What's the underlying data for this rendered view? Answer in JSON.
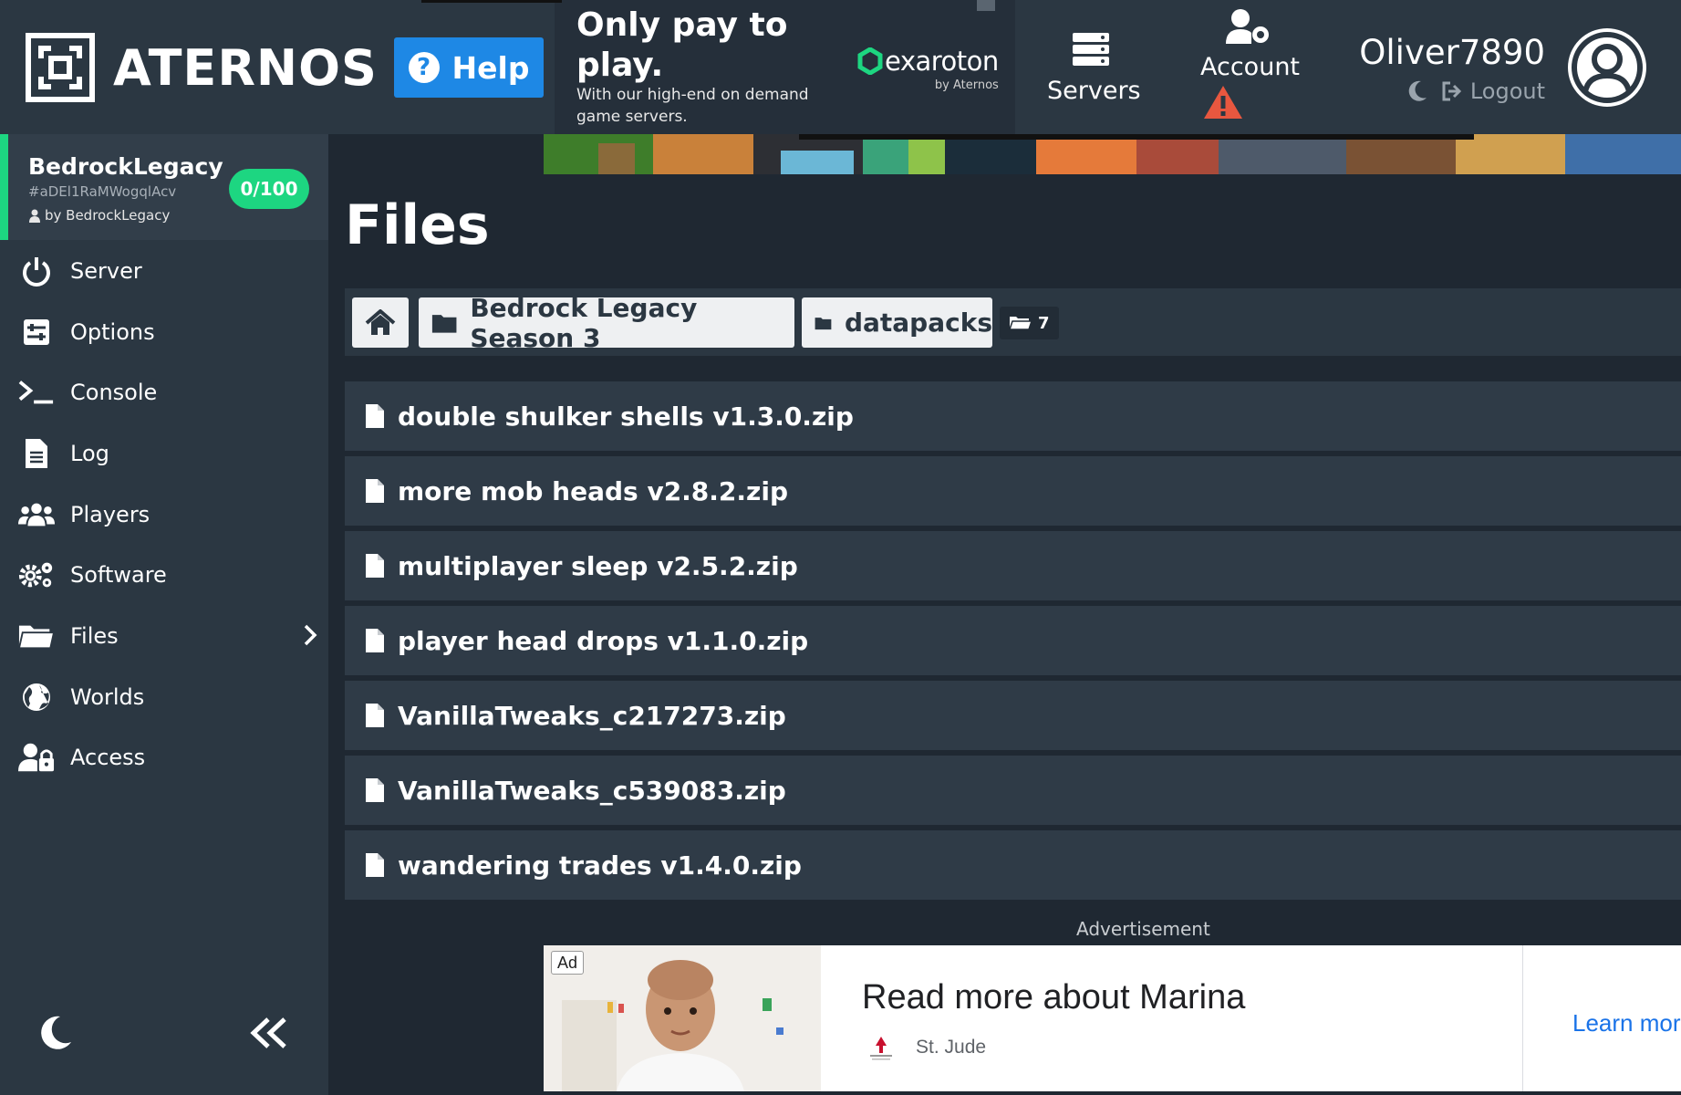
{
  "header": {
    "brand": "ATERNOS",
    "help_label": "Help",
    "top_ad": {
      "headline": "Only pay to play.",
      "subtext": "With our high-end on demand game servers.",
      "sponsor_name": "exaroton",
      "sponsor_by": "by Aternos"
    },
    "nav": {
      "servers_label": "Servers",
      "account_label": "Account"
    },
    "user": {
      "username": "Oliver7890",
      "logout_label": "Logout"
    }
  },
  "sidebar": {
    "server": {
      "name": "BedrockLegacy",
      "id": "#aDEl1RaMWogqlAcv",
      "owner": "by BedrockLegacy",
      "player_count": "0/100"
    },
    "items": [
      {
        "label": "Server",
        "icon": "power-icon"
      },
      {
        "label": "Options",
        "icon": "sliders-icon"
      },
      {
        "label": "Console",
        "icon": "terminal-icon"
      },
      {
        "label": "Log",
        "icon": "document-icon"
      },
      {
        "label": "Players",
        "icon": "users-icon"
      },
      {
        "label": "Software",
        "icon": "gears-icon"
      },
      {
        "label": "Files",
        "icon": "folder-open-icon"
      },
      {
        "label": "Worlds",
        "icon": "globe-icon"
      },
      {
        "label": "Access",
        "icon": "user-lock-icon"
      }
    ]
  },
  "main": {
    "title": "Files",
    "breadcrumb": {
      "items": [
        "Bedrock Legacy Season 3",
        "datapacks"
      ],
      "count": "7"
    },
    "files": [
      "double shulker shells v1.3.0.zip",
      "more mob heads v2.8.2.zip",
      "multiplayer sleep v2.5.2.zip",
      "player head drops v1.1.0.zip",
      "VanillaTweaks_c217273.zip",
      "VanillaTweaks_c539083.zip",
      "wandering trades v1.4.0.zip"
    ],
    "advertisement_label": "Advertisement",
    "bottom_ad": {
      "tag": "Ad",
      "headline": "Read more about Marina",
      "sponsor": "St. Jude",
      "cta": "Learn more"
    }
  },
  "colors": {
    "background": "#1f2832",
    "panel": "#2b3742",
    "accent_green": "#1dd681",
    "help_blue": "#1e88e5",
    "warning_orange": "#e8573f"
  }
}
